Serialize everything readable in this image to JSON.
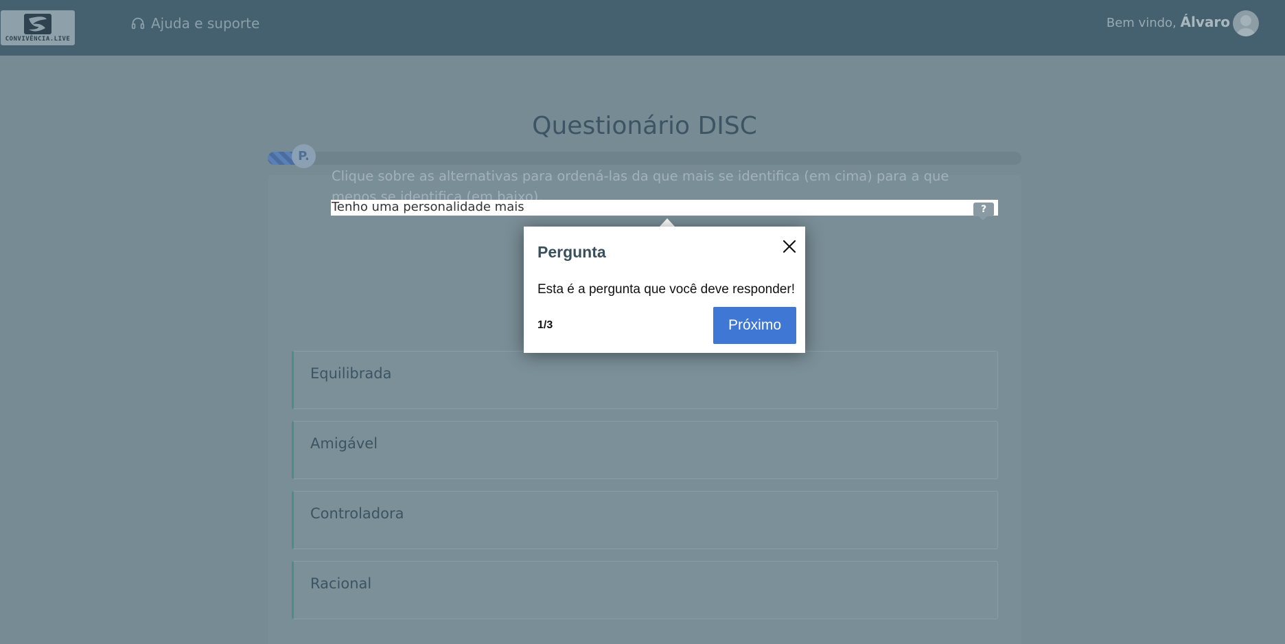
{
  "header": {
    "logo_text": "CONVIVÊNCIA.LIVE",
    "logo_subtext": "",
    "help_label": "Ajuda e suporte",
    "welcome_prefix": "Bem vindo,",
    "user_name": "Álvaro"
  },
  "main": {
    "title": "Questionário DISC",
    "progress_fraction": 0.055,
    "question_badge": "P.",
    "question_text": "Tenho uma personalidade mais",
    "help_badge": "?",
    "instructions": "Clique sobre as alternativas para ordená-las da que mais se identifica (em cima) para a que menos se identifica (em baixo).",
    "options": [
      {
        "label": "Equilibrada"
      },
      {
        "label": "Amigável"
      },
      {
        "label": "Controladora"
      },
      {
        "label": "Racional"
      }
    ]
  },
  "tour": {
    "title": "Pergunta",
    "body": "Esta é a pergunta que você deve responder!",
    "step": "1/3",
    "next_label": "Próximo"
  },
  "colors": {
    "header_bg": "#45606f",
    "overlay_bg": "#778b94",
    "accent_blue": "#3f78d4",
    "option_border": "#4f8d83"
  }
}
